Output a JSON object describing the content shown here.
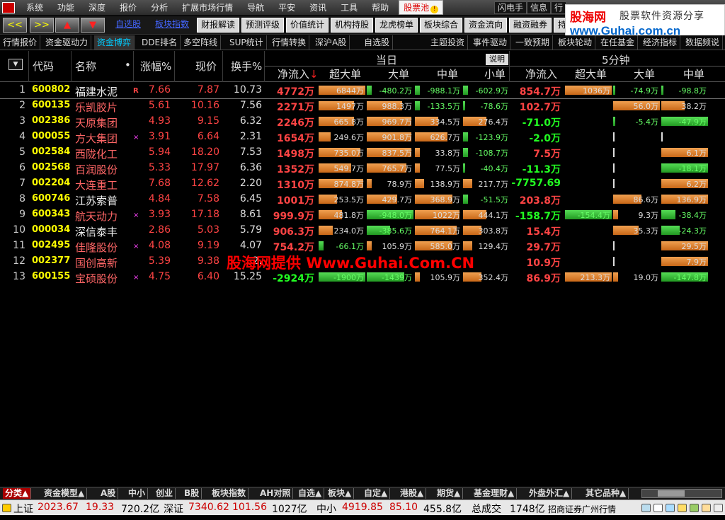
{
  "menu": {
    "items": [
      "系统",
      "功能",
      "深度",
      "报价",
      "分析",
      "扩展市场行情",
      "导航",
      "平安",
      "资讯",
      "工具",
      "帮助"
    ],
    "hot_item": "股票池",
    "right_buttons": [
      "闪电手",
      "信息",
      "行"
    ]
  },
  "brand": {
    "logo": "股海网",
    "slogan": "股票软件资源分享",
    "url": "www.Guhai.com.cn"
  },
  "toolbar": {
    "nav_buttons": [
      "<<",
      ">>",
      "▲",
      "▼"
    ],
    "links": [
      "自选股",
      "板块指数"
    ],
    "buttons": [
      "财报解读",
      "预测评级",
      "价值统计",
      "机构持股",
      "龙虎榜单",
      "板块综合",
      "资金流向",
      "融资融券",
      "持"
    ]
  },
  "tabs2": [
    "行情报价",
    "资金驱动力",
    "资金博弈",
    "DDE排名",
    "多空阵线",
    "SUP统计",
    "行情转换",
    "深沪A股",
    "自选股",
    "主题投资",
    "事件驱动",
    "一致预期",
    "板块轮动",
    "在任基金",
    "经济指标",
    "数据频说"
  ],
  "tabs2_active": 2,
  "header": {
    "group_today": "当日",
    "group_5min": "5分钟",
    "explain_button": "说明",
    "columns": {
      "code": "代码",
      "name": "名称",
      "dot": "•",
      "chg": "涨幅%",
      "price": "现价",
      "turnover": "换手%",
      "net": "净流入",
      "arrow": "↓",
      "xl": "超大单",
      "l": "大单",
      "m": "中单",
      "s": "小单",
      "net5": "净流入",
      "xl5": "超大单",
      "l5": "大单",
      "m5": "中单"
    }
  },
  "rows": [
    {
      "n": "1",
      "code": "600802",
      "name": "福建水泥",
      "flag": "R",
      "chg": "7.66",
      "price": "7.87",
      "turnover": "10.73",
      "net": "4772万",
      "net_color": "red",
      "xl": "6844万",
      "xl_frac": 1.0,
      "xl_c": "o",
      "l": "-480.2万",
      "l_frac": 0.1,
      "l_c": "g",
      "m": "-988.1万",
      "m_frac": 0.1,
      "m_c": "g",
      "s": "-602.9万",
      "s_frac": 0.1,
      "s_c": "g",
      "net5": "854.7万",
      "net5_color": "red",
      "xl5": "1036万",
      "xl5_frac": 1.0,
      "xl5_c": "o",
      "l5": "-74.9万",
      "l5_frac": 0.05,
      "l5_c": "g",
      "m5": "-98.8万",
      "m5_frac": 0.05,
      "m5_c": "g"
    },
    {
      "n": "2",
      "code": "600135",
      "name": "乐凯胶片",
      "flag": "",
      "chg": "5.61",
      "price": "10.16",
      "turnover": "7.56",
      "net": "2271万",
      "net_color": "red",
      "xl": "1497万",
      "xl_frac": 0.75,
      "xl_c": "o",
      "l": "988.3万",
      "l_frac": 0.75,
      "l_c": "o",
      "m": "-133.5万",
      "m_frac": 0.1,
      "m_c": "g",
      "s": "-78.6万",
      "s_frac": 0.05,
      "s_c": "g",
      "net5": "102.7万",
      "net5_color": "red",
      "xl5": "",
      "xl5_frac": 0,
      "xl5_c": "o",
      "l5": "56.0万",
      "l5_frac": 1.0,
      "l5_c": "o",
      "m5": "38.2万",
      "m5_frac": 0.5,
      "m5_c": "o"
    },
    {
      "n": "3",
      "code": "002386",
      "name": "天原集团",
      "flag": "",
      "chg": "4.93",
      "price": "9.15",
      "turnover": "6.32",
      "net": "2246万",
      "net_color": "red",
      "xl": "665.8万",
      "xl_frac": 0.75,
      "xl_c": "o",
      "l": "969.7万",
      "l_frac": 0.95,
      "l_c": "o",
      "m": "334.5万",
      "m_frac": 0.5,
      "m_c": "o",
      "s": "276.4万",
      "s_frac": 0.5,
      "s_c": "o",
      "net5": "-71.0万",
      "net5_color": "grn",
      "xl5": "",
      "xl5_frac": 0,
      "xl5_c": "o",
      "l5": "-5.4万",
      "l5_frac": 0.05,
      "l5_c": "g",
      "m5": "-47.9万",
      "m5_frac": 1.0,
      "m5_c": "g"
    },
    {
      "n": "4",
      "code": "000055",
      "name": "方大集团",
      "flag": "×",
      "chg": "3.91",
      "price": "6.64",
      "turnover": "2.31",
      "net": "1654万",
      "net_color": "red",
      "xl": "249.6万",
      "xl_frac": 0.25,
      "xl_c": "o",
      "l": "901.8万",
      "l_frac": 0.95,
      "l_c": "o",
      "m": "626.7万",
      "m_frac": 0.7,
      "m_c": "o",
      "s": "-123.9万",
      "s_frac": 0.1,
      "s_c": "g",
      "net5": "-2.0万",
      "net5_color": "grn",
      "xl5": "",
      "xl5_frac": 0,
      "xl5_c": "o",
      "l5": "",
      "l5_frac": 0.02,
      "l5_c": "w",
      "m5": "",
      "m5_frac": 0.02,
      "m5_c": "w"
    },
    {
      "n": "5",
      "code": "002584",
      "name": "西陇化工",
      "flag": "",
      "chg": "5.94",
      "price": "18.20",
      "turnover": "7.53",
      "net": "1498万",
      "net_color": "red",
      "xl": "735.0万",
      "xl_frac": 0.9,
      "xl_c": "o",
      "l": "837.5万",
      "l_frac": 0.95,
      "l_c": "o",
      "m": "33.8万",
      "m_frac": 0.1,
      "m_c": "o",
      "s": "-108.7万",
      "s_frac": 0.1,
      "s_c": "g",
      "net5": "7.5万",
      "net5_color": "red",
      "xl5": "",
      "xl5_frac": 0,
      "xl5_c": "o",
      "l5": "",
      "l5_frac": 0.02,
      "l5_c": "w",
      "m5": "6.1万",
      "m5_frac": 1.0,
      "m5_c": "o"
    },
    {
      "n": "6",
      "code": "002568",
      "name": "百润股份",
      "flag": "",
      "chg": "5.33",
      "price": "17.97",
      "turnover": "6.36",
      "net": "1352万",
      "net_color": "red",
      "xl": "549.7万",
      "xl_frac": 0.7,
      "xl_c": "o",
      "l": "765.7万",
      "l_frac": 0.85,
      "l_c": "o",
      "m": "77.5万",
      "m_frac": 0.1,
      "m_c": "o",
      "s": "-40.4万",
      "s_frac": 0.05,
      "s_c": "g",
      "net5": "-11.3万",
      "net5_color": "grn",
      "xl5": "",
      "xl5_frac": 0,
      "xl5_c": "o",
      "l5": "",
      "l5_frac": 0.02,
      "l5_c": "w",
      "m5": "-18.1万",
      "m5_frac": 1.0,
      "m5_c": "g"
    },
    {
      "n": "7",
      "code": "002204",
      "name": "大连重工",
      "flag": "",
      "chg": "7.68",
      "price": "12.62",
      "turnover": "2.20",
      "net": "1310万",
      "net_color": "red",
      "xl": "874.8万",
      "xl_frac": 0.95,
      "xl_c": "o",
      "l": "78.9万",
      "l_frac": 0.1,
      "l_c": "o",
      "m": "138.9万",
      "m_frac": 0.2,
      "m_c": "o",
      "s": "217.7万",
      "s_frac": 0.2,
      "s_c": "o",
      "net5": "-7757.69",
      "net5_color": "grn",
      "xl5": "",
      "xl5_frac": 0,
      "xl5_c": "o",
      "l5": "",
      "l5_frac": 0.02,
      "l5_c": "w",
      "m5": "6.2万",
      "m5_frac": 1.0,
      "m5_c": "o"
    },
    {
      "n": "8",
      "code": "600746",
      "name": "江苏索普",
      "flag": "",
      "chg": "4.84",
      "price": "7.58",
      "turnover": "6.45",
      "net": "1001万",
      "net_color": "red",
      "xl": "253.5万",
      "xl_frac": 0.4,
      "xl_c": "o",
      "l": "429.7万",
      "l_frac": 0.65,
      "l_c": "o",
      "m": "368.9万",
      "m_frac": 0.8,
      "m_c": "o",
      "s": "-51.5万",
      "s_frac": 0.1,
      "s_c": "g",
      "net5": "203.8万",
      "net5_color": "red",
      "xl5": "",
      "xl5_frac": 0,
      "xl5_c": "o",
      "l5": "86.6万",
      "l5_frac": 0.6,
      "l5_c": "o",
      "m5": "136.9万",
      "m5_frac": 1.0,
      "m5_c": "o"
    },
    {
      "n": "9",
      "code": "600343",
      "name": "航天动力",
      "flag": "×",
      "chg": "3.93",
      "price": "17.18",
      "turnover": "8.61",
      "net": "999.9万",
      "net_color": "red",
      "xl": "481.8万",
      "xl_frac": 0.5,
      "xl_c": "o",
      "l": "-948.0万",
      "l_frac": 1.0,
      "l_c": "g",
      "m": "1022万",
      "m_frac": 0.95,
      "m_c": "o",
      "s": "444.1万",
      "s_frac": 0.5,
      "s_c": "o",
      "net5": "-158.7万",
      "net5_color": "grn",
      "xl5": "-154.4万",
      "xl5_frac": 1.0,
      "xl5_c": "g",
      "l5": "9.3万",
      "l5_frac": 0.1,
      "l5_c": "o",
      "m5": "-38.4万",
      "m5_frac": 0.3,
      "m5_c": "g"
    },
    {
      "n": "10",
      "code": "000034",
      "name": "深信泰丰",
      "flag": "",
      "chg": "2.86",
      "price": "5.03",
      "turnover": "5.79",
      "net": "906.3万",
      "net_color": "red",
      "xl": "234.0万",
      "xl_frac": 0.3,
      "xl_c": "o",
      "l": "-385.6万",
      "l_frac": 0.5,
      "l_c": "g",
      "m": "764.1万",
      "m_frac": 0.9,
      "m_c": "o",
      "s": "303.8万",
      "s_frac": 0.4,
      "s_c": "o",
      "net5": "15.4万",
      "net5_color": "red",
      "xl5": "",
      "xl5_frac": 0,
      "xl5_c": "o",
      "l5": "35.3万",
      "l5_frac": 0.55,
      "l5_c": "o",
      "m5": "-24.3万",
      "m5_frac": 0.4,
      "m5_c": "g"
    },
    {
      "n": "11",
      "code": "002495",
      "name": "佳隆股份",
      "flag": "×",
      "chg": "4.08",
      "price": "9.19",
      "turnover": "4.07",
      "net": "754.2万",
      "net_color": "red",
      "xl": "-66.1万",
      "xl_frac": 0.1,
      "xl_c": "g",
      "l": "105.9万",
      "l_frac": 0.1,
      "l_c": "o",
      "m": "585.0万",
      "m_frac": 0.8,
      "m_c": "o",
      "s": "129.4万",
      "s_frac": 0.2,
      "s_c": "o",
      "net5": "29.7万",
      "net5_color": "red",
      "xl5": "",
      "xl5_frac": 0,
      "xl5_c": "o",
      "l5": "",
      "l5_frac": 0.02,
      "l5_c": "w",
      "m5": "29.5万",
      "m5_frac": 1.0,
      "m5_c": "o"
    },
    {
      "n": "12",
      "code": "002377",
      "name": "国创高新",
      "flag": "",
      "chg": "5.39",
      "price": "9.38",
      "turnover": "2.",
      "net": "",
      "net_color": "red",
      "xl": "",
      "xl_frac": 0,
      "xl_c": "o",
      "l": "",
      "l_frac": 0,
      "l_c": "o",
      "m": "",
      "m_frac": 0,
      "m_c": "o",
      "s": "",
      "s_frac": 0,
      "s_c": "o",
      "net5": "10.9万",
      "net5_color": "red",
      "xl5": "",
      "xl5_frac": 0,
      "xl5_c": "o",
      "l5": "",
      "l5_frac": 0.02,
      "l5_c": "w",
      "m5": "7.9万",
      "m5_frac": 1.0,
      "m5_c": "o"
    },
    {
      "n": "13",
      "code": "600155",
      "name": "宝硕股份",
      "flag": "×",
      "chg": "4.75",
      "price": "6.40",
      "turnover": "15.25",
      "net": "-2924万",
      "net_color": "grn",
      "xl": "-1900万",
      "xl_frac": 1.0,
      "xl_c": "g",
      "l": "-1439万",
      "l_frac": 0.8,
      "l_c": "g",
      "m": "105.9万",
      "m_frac": 0.1,
      "m_c": "o",
      "s": "352.4万",
      "s_frac": 0.4,
      "s_c": "o",
      "net5": "86.9万",
      "net5_color": "red",
      "xl5": "213.3万",
      "xl5_frac": 1.0,
      "xl5_c": "o",
      "l5": "19.0万",
      "l5_frac": 0.1,
      "l5_c": "o",
      "m5": "-147.8万",
      "m5_frac": 1.0,
      "m5_c": "g"
    }
  ],
  "watermark": "股海网提供 Www.Guhai.Com.CN",
  "bottom_tabs": [
    "分类▲",
    "资金模型▲",
    "A股",
    "中小",
    "创业",
    "B股",
    "板块指数",
    "AH对照",
    "自选▲",
    "板块▲",
    "自定▲",
    "港股▲",
    "期货▲",
    "基金理财▲",
    "外盘外汇▲",
    "其它品种▲"
  ],
  "bottom_active": 0,
  "status": {
    "sh_label": "上证",
    "sh_val": "2023.67",
    "sh_chg": "19.33",
    "sh_amt": "720.2亿",
    "sz_label": "深证",
    "sz_val": "7340.62",
    "sz_chg": "101.56",
    "sz_amt": "1027亿",
    "zx_label": "中小",
    "zx_val": "4919.85",
    "zx_chg": "85.10",
    "zx_amt": "455.8亿",
    "total_label": "总成交",
    "total_amt": "1748亿",
    "broker": "招商证券广州行情"
  },
  "colors": {
    "up": "#ff4444",
    "down": "#22ff22",
    "bar_up": "#e88a3a",
    "bar_down": "#3fbf3f",
    "code": "#ffff00"
  }
}
